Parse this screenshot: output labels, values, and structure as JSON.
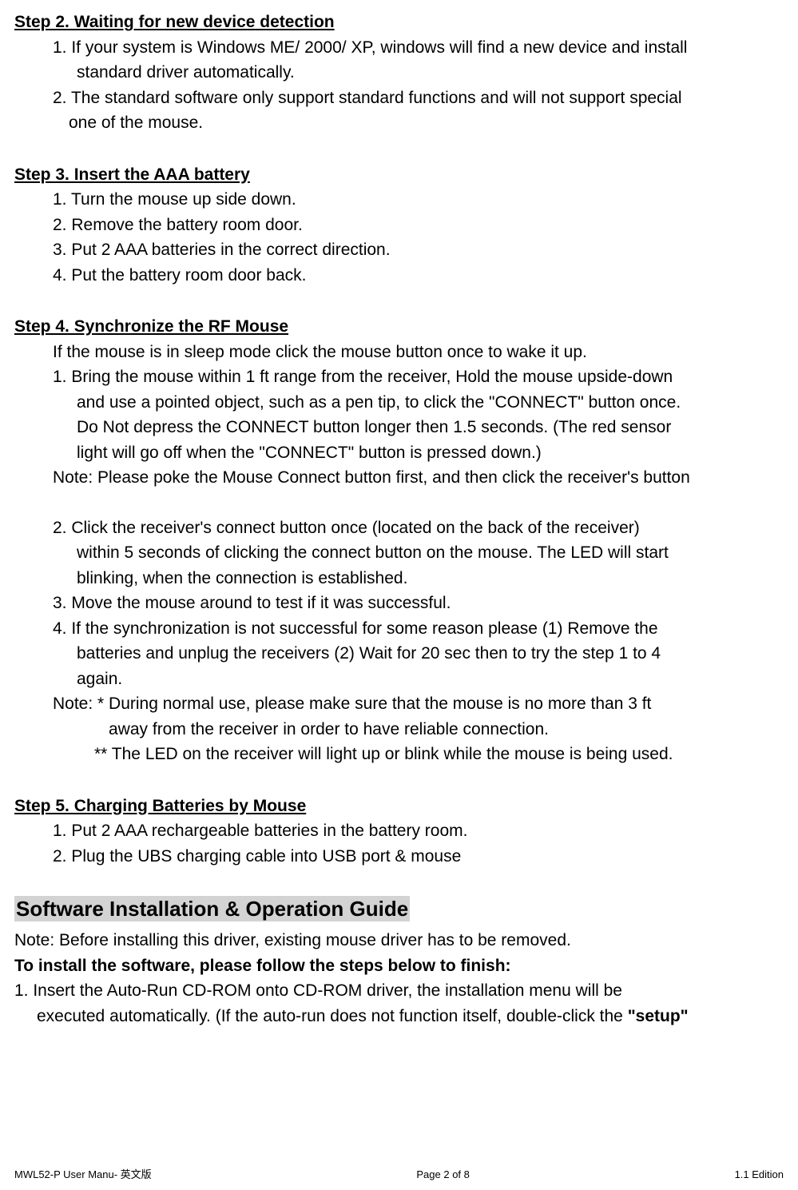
{
  "step2": {
    "heading": "Step 2. Waiting for new device detection",
    "item1_line1": "1. If your system is Windows ME/ 2000/ XP, windows will find a new device and install",
    "item1_line2": "standard driver automatically.",
    "item2_line1": "2. The standard software only support standard functions and will not support special",
    "item2_line2": "one of the mouse."
  },
  "step3": {
    "heading": "Step 3. Insert the AAA battery",
    "item1": "1.  Turn the mouse up side down.",
    "item2": "2.  Remove the battery room door.",
    "item3": "3.  Put 2 AAA batteries in the correct direction.",
    "item4": "4.  Put the battery room door back."
  },
  "step4": {
    "heading": "Step 4. Synchronize the RF Mouse",
    "intro": "If the mouse is in sleep mode click the mouse button once to wake it up.",
    "item1_line1": "1.  Bring the mouse within 1 ft range from the receiver, Hold the mouse upside-down",
    "item1_line2": "and use a pointed object, such as a pen tip, to click the \"CONNECT\" button once.",
    "item1_line3": "Do Not depress the CONNECT button longer then 1.5 seconds. (The red sensor",
    "item1_line4": "light will go off when the \"CONNECT\" button is pressed down.)",
    "note1": "Note: Please poke the Mouse Connect button first, and then click the receiver's button",
    "item2_line1": "2.  Click the receiver's connect button once (located on the back of the receiver)",
    "item2_line2": "within 5 seconds of clicking the connect button on the mouse.    The LED will start",
    "item2_line3": "blinking, when the connection is established.",
    "item3": "3.  Move the mouse around to test if it was successful.",
    "item4_line1": "4.  If the synchronization is not successful for some reason please (1) Remove the",
    "item4_line2": "batteries and unplug the receivers (2) Wait for 20 sec then to try the step 1 to 4",
    "item4_line3": "again.",
    "note2_line1": "Note: * During normal use, please make sure that the mouse is no more than 3 ft",
    "note2_line2": "away from the receiver in order to have reliable connection.",
    "note2_line3": "** The LED on the receiver will light up or blink while the mouse is being used."
  },
  "step5": {
    "heading": "Step 5. Charging Batteries by Mouse",
    "item1": "1.  Put 2 AAA rechargeable batteries in the battery room.",
    "item2": "2.  Plug the UBS charging cable into USB port & mouse"
  },
  "software": {
    "heading": "Software Installation & Operation Guide",
    "note": "Note: Before installing this driver, existing mouse driver has to be removed.",
    "install_heading": "To install the software, please follow the steps below to finish:",
    "item1_line1": "1. Insert the Auto-Run CD-ROM onto CD-ROM driver, the installation menu will be",
    "item1_line2_a": "executed automatically. (If the auto-run does not function itself, double-click the ",
    "item1_line2_b": "\"setup\""
  },
  "footer": {
    "left": "MWL52-P User Manu-  英文版",
    "center": "Page 2 of 8",
    "right": "1.1 Edition"
  }
}
